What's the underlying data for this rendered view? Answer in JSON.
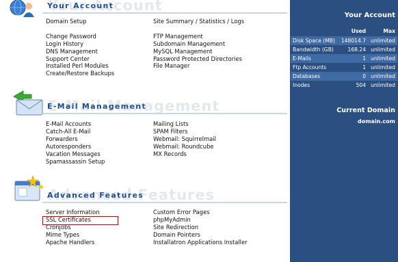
{
  "your_account": {
    "title": "Your Account",
    "col1": [
      "Domain Setup",
      "",
      "Change Password",
      "Login History",
      "DNS Management",
      "Support Center",
      "Installed Perl Modules",
      "Create/Restore Backups"
    ],
    "col2": [
      "Site Summary / Statistics / Logs",
      "",
      "FTP Management",
      "Subdomain Management",
      "MySQL Management",
      "Password Protected Directories",
      "File Manager"
    ]
  },
  "email": {
    "title": "E-Mail Management",
    "col1": [
      "E-Mail Accounts",
      "Catch-All E-Mail",
      "Forwarders",
      "Autoresponders",
      "Vacation Messages",
      "Spamassassin Setup"
    ],
    "col2": [
      "Mailing Lists",
      "SPAM Filters",
      "Webmail: Squirrelmail",
      "Webmail: Roundcube",
      "MX Records"
    ]
  },
  "advanced": {
    "title": "Advanced Features",
    "col1": [
      "Server Information",
      "SSL Certificates",
      "Cronjobs",
      "Mime Types",
      "Apache Handlers"
    ],
    "col2": [
      "Custom Error Pages",
      "phpMyAdmin",
      "Site Redirection",
      "Domain Pointers",
      "Installatron Applications Installer"
    ]
  },
  "sidebar": {
    "title": "Your Account",
    "headers": {
      "used": "Used",
      "max": "Max"
    },
    "rows": [
      {
        "label": "Disk Space (MB)",
        "used": "148014.7",
        "max": "unlimited"
      },
      {
        "label": "Bandwidth (GB)",
        "used": "168.24",
        "max": "unlimited"
      },
      {
        "label": "E-Mails",
        "used": "1",
        "max": "unlimited"
      },
      {
        "label": "Ftp Accounts",
        "used": "1",
        "max": "unlimited"
      },
      {
        "label": "Databases",
        "used": "0",
        "max": "unlimited"
      },
      {
        "label": "Inodes",
        "used": "504",
        "max": "unlimited"
      }
    ],
    "current_domain_title": "Current Domain",
    "current_domain": "domain.com"
  },
  "colors": {
    "sidebar_bg": "#2c4f82",
    "sidebar_row_alt": "#3f6aa3",
    "title_blue": "#1d4f91",
    "highlight_border": "#8b1a1a"
  },
  "icons": {
    "your_account": "globe-user-icon",
    "email": "envelope-arrow-icon",
    "advanced": "window-stars-icon"
  }
}
